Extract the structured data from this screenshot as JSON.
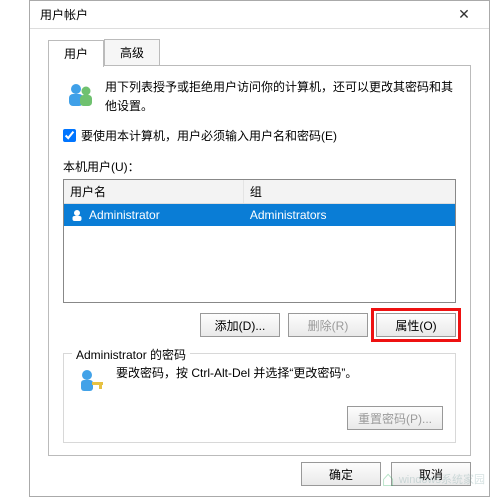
{
  "title": "用户帐户",
  "tabs": {
    "user": "用户",
    "advanced": "高级"
  },
  "intro": "用下列表授予或拒绝用户访问你的计算机，还可以更改其密码和其他设置。",
  "checkbox_label": "要使用本计算机，用户必须输入用户名和密码(E)",
  "section_label": "本机用户(U)：",
  "columns": {
    "user": "用户名",
    "group": "组"
  },
  "rows": [
    {
      "user": "Administrator",
      "group": "Administrators"
    }
  ],
  "buttons": {
    "add": "添加(D)...",
    "remove": "删除(R)",
    "properties": "属性(O)"
  },
  "pw": {
    "legend": "Administrator 的密码",
    "text": "要改密码，按 Ctrl-Alt-Del 并选择“更改密码”。",
    "reset": "重置密码(P)..."
  },
  "dialog_buttons": {
    "ok": "确定",
    "cancel": "取消"
  },
  "watermark": "windows系统家园"
}
